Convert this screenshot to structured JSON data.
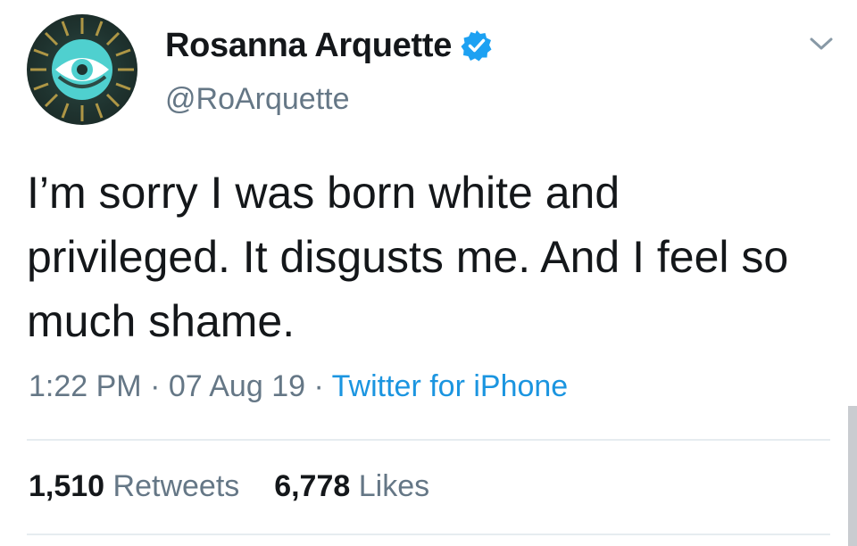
{
  "user": {
    "display_name": "Rosanna Arquette",
    "handle": "@RoArquette",
    "verified": true,
    "avatar_icon": "eye-icon"
  },
  "tweet": {
    "text": "I’m sorry I was born white and privileged. It disgusts me. And I feel so much shame.",
    "time": "1:22 PM",
    "date": "07 Aug 19",
    "separator": "·",
    "source": "Twitter for iPhone"
  },
  "stats": {
    "retweets_count": "1,510",
    "retweets_label": "Retweets",
    "likes_count": "6,778",
    "likes_label": "Likes"
  },
  "colors": {
    "text": "#14171a",
    "secondary": "#657786",
    "link": "#1b95e0",
    "verified": "#1da1f2"
  },
  "icons": {
    "menu": "chevron-down-icon",
    "verified": "verified-badge-icon"
  }
}
